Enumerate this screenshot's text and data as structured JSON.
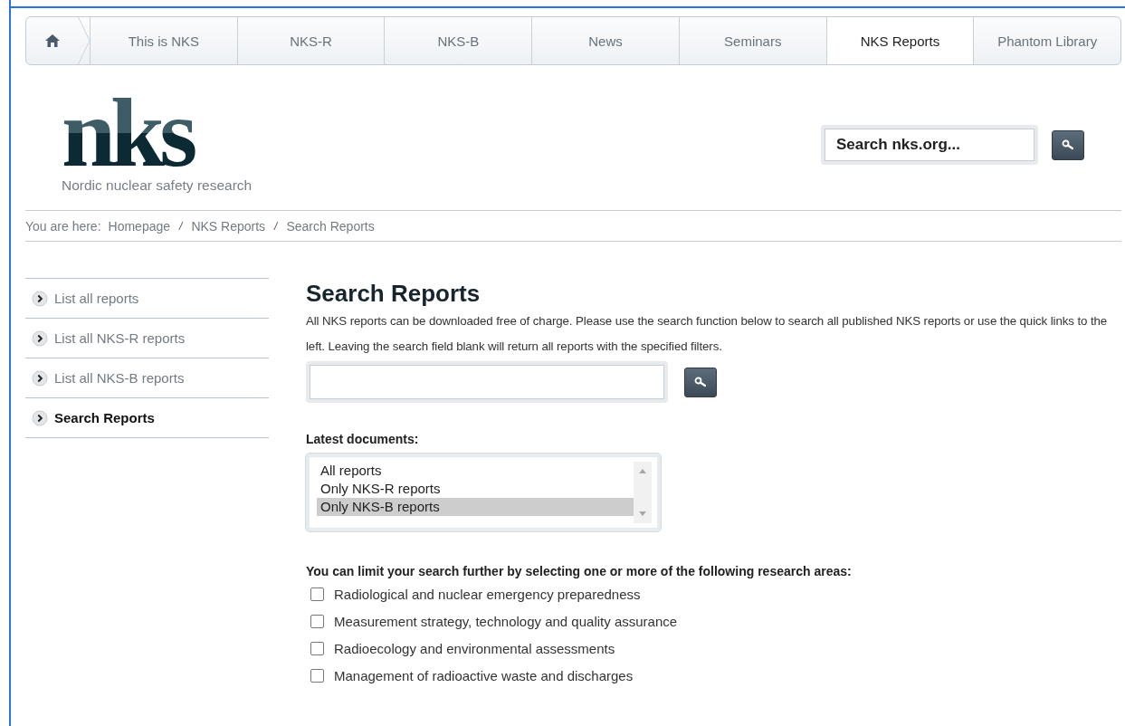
{
  "nav": {
    "tabs": [
      {
        "label": "This is NKS",
        "selected": false
      },
      {
        "label": "NKS-R",
        "selected": false
      },
      {
        "label": "NKS-B",
        "selected": false
      },
      {
        "label": "News",
        "selected": false
      },
      {
        "label": "Seminars",
        "selected": false
      },
      {
        "label": "NKS Reports",
        "selected": true
      },
      {
        "label": "Phantom Library",
        "selected": false
      }
    ]
  },
  "logo": {
    "wordmark": "nks",
    "tagline": "Nordic nuclear safety research"
  },
  "site_search": {
    "placeholder": "Search nks.org..."
  },
  "breadcrumb": {
    "label": "You are here:",
    "items": [
      "Homepage",
      "NKS Reports",
      "Search Reports"
    ],
    "separators": [
      "/",
      "/"
    ]
  },
  "sidebar": {
    "items": [
      {
        "label": "List all reports",
        "selected": false
      },
      {
        "label": "List all NKS-R reports",
        "selected": false
      },
      {
        "label": "List all NKS-B reports",
        "selected": false
      },
      {
        "label": "Search Reports",
        "selected": true
      }
    ]
  },
  "main": {
    "title": "Search Reports",
    "intro": "All NKS reports can be downloaded free of charge. Please use the search function below to search all published NKS reports or use the quick links to the left. Leaving the search field blank will return all reports with the specified filters.",
    "latest_label": "Latest documents:",
    "latest_options": [
      {
        "label": "All reports",
        "selected": false
      },
      {
        "label": "Only NKS-R reports",
        "selected": false
      },
      {
        "label": "Only NKS-B reports",
        "selected": true
      }
    ],
    "areas_label": "You can limit your search further by selecting one or more of the following research areas:",
    "areas": [
      {
        "label": "Radiological and nuclear emergency preparedness",
        "checked": false
      },
      {
        "label": "Measurement strategy, technology and quality assurance",
        "checked": false
      },
      {
        "label": "Radioecology and environmental assessments",
        "checked": false
      },
      {
        "label": "Management of radioactive waste and discharges",
        "checked": false
      }
    ]
  }
}
